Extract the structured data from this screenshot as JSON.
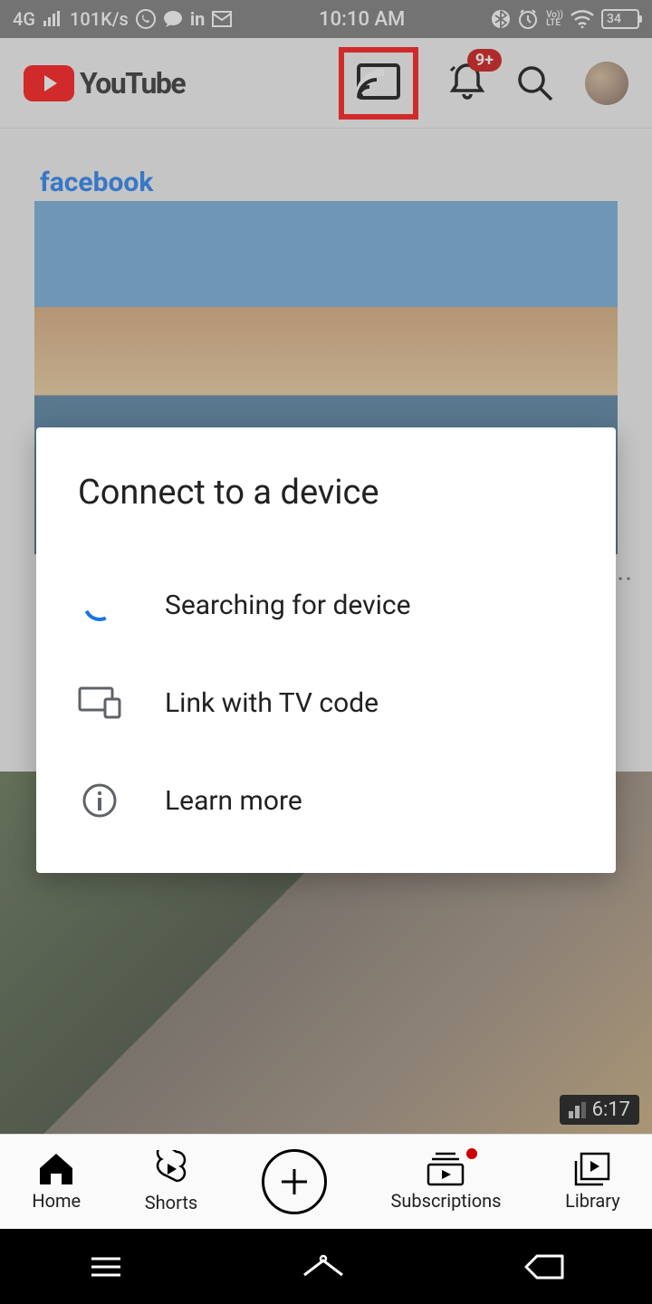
{
  "status": {
    "network": "4G",
    "speed": "101K/s",
    "time": "10:10 AM",
    "battery": "34",
    "lte": "Vo))\nLTE"
  },
  "header": {
    "app_name": "YouTube",
    "badge": "9+"
  },
  "feed": {
    "ad_brand": "facebook",
    "video_duration": "6:17"
  },
  "dialog": {
    "title": "Connect to a device",
    "searching": "Searching for device",
    "link_tv": "Link with TV code",
    "learn_more": "Learn more"
  },
  "tabs": {
    "home": "Home",
    "shorts": "Shorts",
    "subscriptions": "Subscriptions",
    "library": "Library"
  }
}
